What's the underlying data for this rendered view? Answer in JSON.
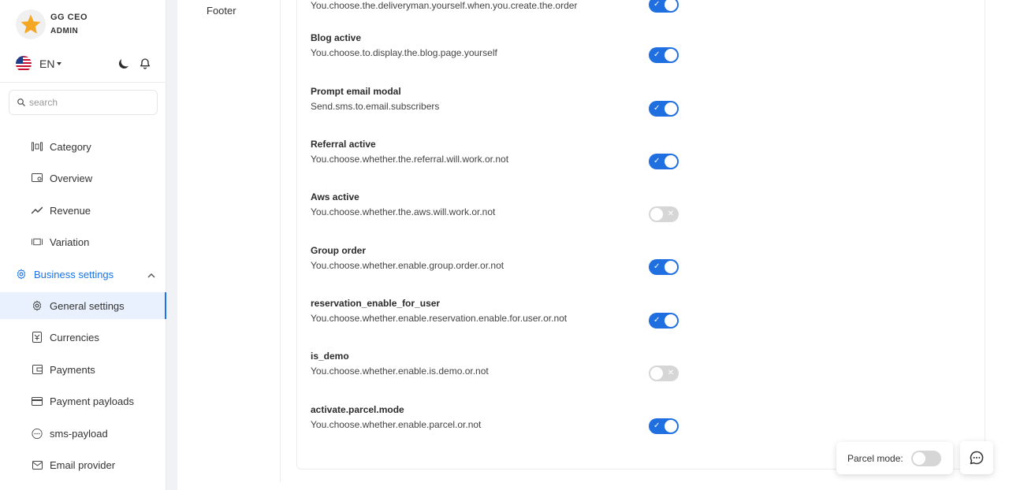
{
  "profile": {
    "name": "GG CEO",
    "role": "ADMIN"
  },
  "language": {
    "current": "EN"
  },
  "search": {
    "placeholder": "search"
  },
  "sidebar": {
    "items": [
      {
        "label": "Category",
        "icon": "category-icon"
      },
      {
        "label": "Overview",
        "icon": "overview-icon"
      },
      {
        "label": "Revenue",
        "icon": "revenue-icon"
      },
      {
        "label": "Variation",
        "icon": "variation-icon"
      }
    ],
    "business_settings": {
      "label": "Business settings",
      "children": [
        {
          "label": "General settings",
          "icon": "gear-icon",
          "active": true
        },
        {
          "label": "Currencies",
          "icon": "currency-icon"
        },
        {
          "label": "Payments",
          "icon": "wallet-icon"
        },
        {
          "label": "Payment payloads",
          "icon": "card-icon"
        },
        {
          "label": "sms-payload",
          "icon": "chat-dots-icon"
        },
        {
          "label": "Email provider",
          "icon": "mail-icon"
        }
      ]
    }
  },
  "inner_nav": {
    "footer_label": "Footer"
  },
  "settings": [
    {
      "title": "",
      "description": "You.choose.the.deliveryman.yourself.when.you.create.the.order",
      "enabled": true
    },
    {
      "title": "Blog active",
      "description": "You.choose.to.display.the.blog.page.yourself",
      "enabled": true
    },
    {
      "title": "Prompt email modal",
      "description": "Send.sms.to.email.subscribers",
      "enabled": true
    },
    {
      "title": "Referral active",
      "description": "You.choose.whether.the.referral.will.work.or.not",
      "enabled": true
    },
    {
      "title": "Aws active",
      "description": "You.choose.whether.the.aws.will.work.or.not",
      "enabled": false
    },
    {
      "title": "Group order",
      "description": "You.choose.whether.enable.group.order.or.not",
      "enabled": true
    },
    {
      "title": "reservation_enable_for_user",
      "description": "You.choose.whether.enable.reservation.enable.for.user.or.not",
      "enabled": true
    },
    {
      "title": "is_demo",
      "description": "You.choose.whether.enable.is.demo.or.not",
      "enabled": false
    },
    {
      "title": "activate.parcel.mode",
      "description": "You.choose.whether.enable.parcel.or.not",
      "enabled": true
    }
  ],
  "parcel_mode": {
    "label": "Parcel mode:",
    "enabled": false
  },
  "colors": {
    "accent": "#1a73e8",
    "toggle_on": "#1f6fe0",
    "toggle_off": "#d6d6d6",
    "star": "#f5a623"
  }
}
